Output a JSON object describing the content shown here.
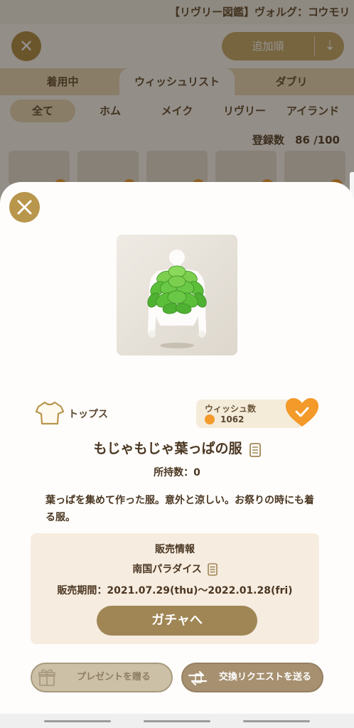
{
  "app": {
    "window_title": "【リヴリー図鑑】ヴォルグ：コウモリ"
  },
  "background": {
    "sort_label": "追加順",
    "tabs": [
      {
        "label": "着用中"
      },
      {
        "label": "ウィッシュリスト"
      },
      {
        "label": "ダブリ"
      }
    ],
    "categories": [
      {
        "label": "全て"
      },
      {
        "label": "ホム"
      },
      {
        "label": "メイク"
      },
      {
        "label": "リヴリー"
      },
      {
        "label": "アイランド"
      }
    ],
    "count_label": "登録数",
    "count_value": "86 /100"
  },
  "item": {
    "category_icon": "shirt-icon",
    "category": "トップス",
    "wish_label": "ウィッシュ数",
    "wish_count": "1062",
    "name": "もじゃもじゃ葉っぱの服",
    "owned": "所持数：0",
    "description": "葉っぱを集めて作った服。意外と涼しい。お祭りの時にも着る服。"
  },
  "sale": {
    "heading": "販売情報",
    "place": "南国パラダイス",
    "period": "販売期間：2021.07.29(thu)～2022.01.28(fri)",
    "gacha_button": "ガチャへ"
  },
  "actions": {
    "gift_button": "プレゼントを贈る",
    "trade_button": "交換リクエストを送る"
  },
  "colors": {
    "accent_gold": "#b8964c",
    "heart_orange": "#f39a2a",
    "sale_panel": "#f6ece0",
    "leaf_green": "#5cbf3a"
  }
}
